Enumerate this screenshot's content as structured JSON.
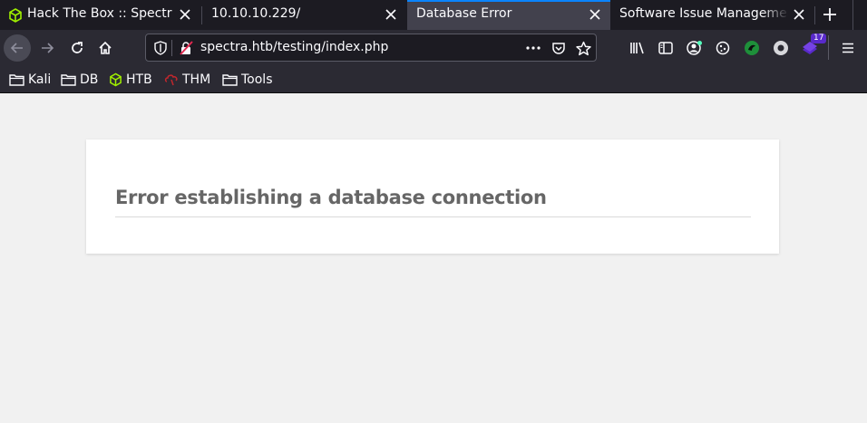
{
  "tabs": [
    {
      "title": "Hack The Box :: Spectra",
      "icon": "htb-cube-icon",
      "active": false
    },
    {
      "title": "10.10.10.229/",
      "active": false
    },
    {
      "title": "Database Error",
      "active": true
    },
    {
      "title": "Software Issue Management",
      "active": false
    }
  ],
  "navbar": {
    "url": "spectra.htb/testing/index.php",
    "extension_badge": "17"
  },
  "bookmarks": [
    {
      "label": "Kali",
      "icon": "folder-icon"
    },
    {
      "label": "DB",
      "icon": "folder-icon"
    },
    {
      "label": "HTB",
      "icon": "htb-cube-icon"
    },
    {
      "label": "THM",
      "icon": "thm-icon"
    },
    {
      "label": "Tools",
      "icon": "folder-icon"
    }
  ],
  "page": {
    "error_heading": "Error establishing a database connection"
  },
  "colors": {
    "accent": "#0a84ff",
    "htb_green": "#9fef00",
    "heading_text": "#666666",
    "page_background": "#f1f1f1"
  }
}
